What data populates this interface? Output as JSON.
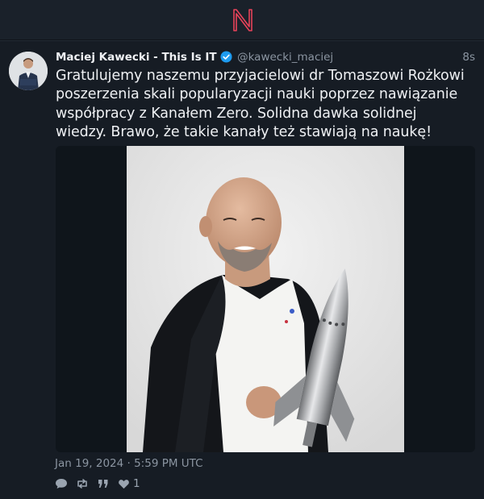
{
  "app": {
    "logo_letter": "N",
    "accent_color": "#e8435a"
  },
  "tweet": {
    "author_name": "Maciej Kawecki - This Is IT",
    "handle": "@kawecki_maciej",
    "time_ago": "8s",
    "text": "Gratulujemy naszemu przyjacielowi dr Tomaszowi Rożkowi poszerzenia skali popularyzacji nauki poprzez nawiązanie współpracy z Kanałem Zero. Solidna dawka solidnej wiedzy. Brawo, że takie kanały też stawiają na naukę!",
    "timestamp": "Jan 19, 2024 · 5:59 PM UTC",
    "verified_color": "#1d9bf0",
    "icons": [
      "reply-icon",
      "repost-icon",
      "quote-icon",
      "heart-icon"
    ],
    "likes": "1"
  }
}
